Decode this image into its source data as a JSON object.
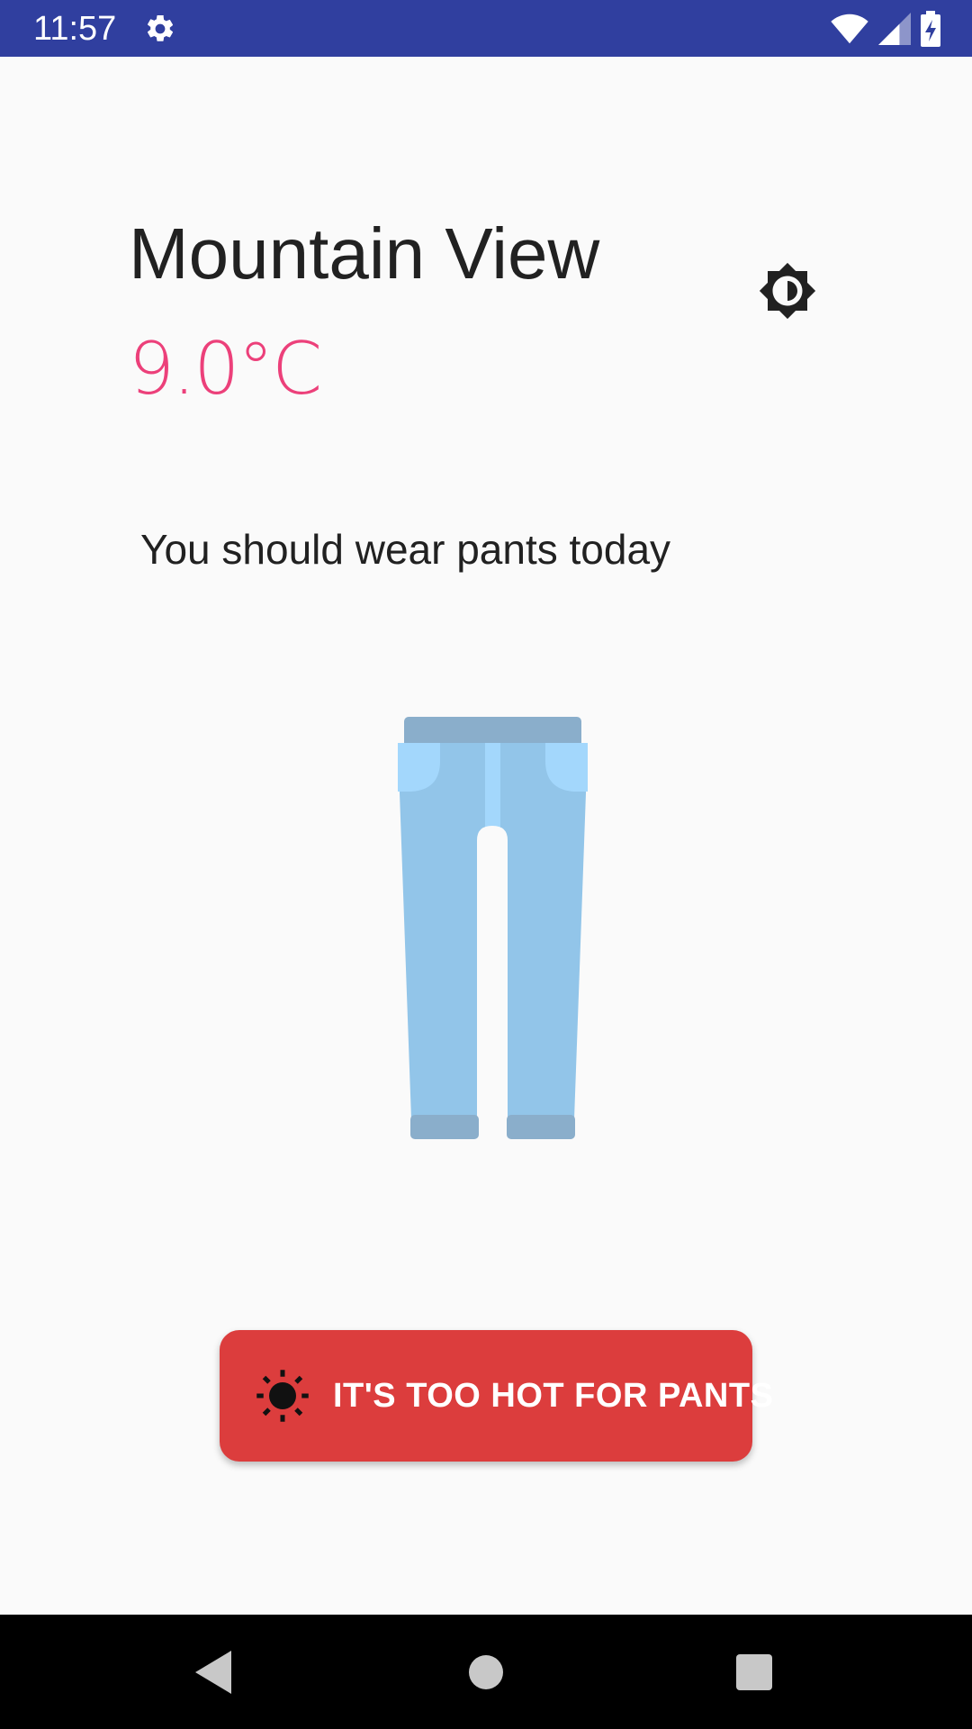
{
  "status_bar": {
    "time": "11:57",
    "icons": [
      "settings-icon",
      "wifi-icon",
      "cellular-signal-icon",
      "battery-charging-icon"
    ],
    "background_color": "#303f9f"
  },
  "weather": {
    "city": "Mountain View",
    "temperature": "9.0°C",
    "temperature_color": "#ec407a"
  },
  "theme_toggle": {
    "icon": "brightness-icon"
  },
  "recommendation": {
    "text": "You should wear pants today",
    "illustration": "pants-illustration"
  },
  "action_button": {
    "label": "IT'S TOO HOT FOR PANTS",
    "icon": "sun-icon",
    "color": "#dc3d3d"
  },
  "nav_bar": {
    "buttons": [
      "back-icon",
      "home-icon",
      "recents-icon"
    ]
  }
}
